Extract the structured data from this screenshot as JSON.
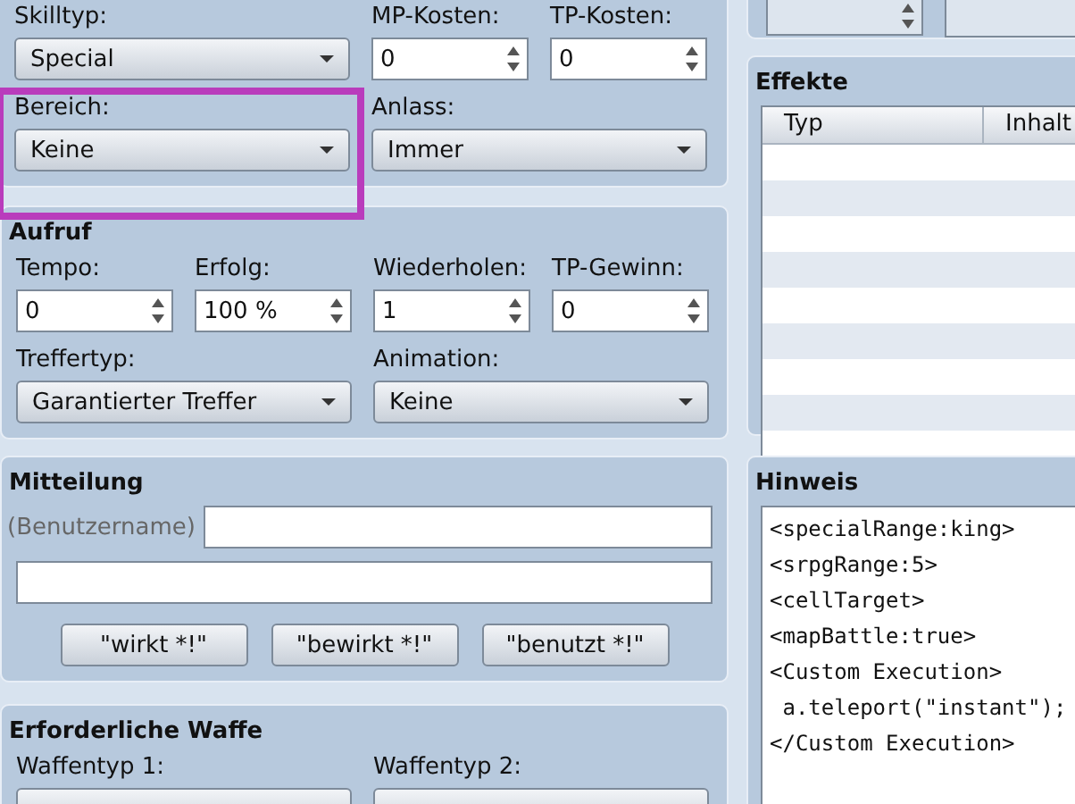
{
  "general": {
    "fields": [
      {
        "kind": "dropdown",
        "label": "Skilltyp:",
        "value": "Special",
        "highlighted": false
      },
      {
        "kind": "spinner",
        "label": "MP-Kosten:",
        "value": "0",
        "highlighted": false
      },
      {
        "kind": "spinner",
        "label": "TP-Kosten:",
        "value": "0",
        "highlighted": false
      },
      {
        "kind": "dropdown",
        "label": "Bereich:",
        "value": "Keine",
        "highlighted": true
      },
      {
        "kind": "dropdown",
        "label": "Anlass:",
        "value": "Immer",
        "highlighted": false
      }
    ]
  },
  "invocation": {
    "title": "Aufruf",
    "fields": [
      {
        "kind": "spinner",
        "label": "Tempo:",
        "value": "0",
        "highlighted": false
      },
      {
        "kind": "spinner",
        "label": "Erfolg:",
        "value": "100 %",
        "highlighted": false
      },
      {
        "kind": "spinner",
        "label": "Wiederholen:",
        "value": "1",
        "highlighted": false
      },
      {
        "kind": "spinner",
        "label": "TP-Gewinn:",
        "value": "0",
        "highlighted": false
      },
      {
        "kind": "dropdown",
        "label": "Treffertyp:",
        "value": "Garantierter Treffer",
        "highlighted": false
      },
      {
        "kind": "dropdown",
        "label": "Animation:",
        "value": "Keine",
        "highlighted": false
      }
    ]
  },
  "message": {
    "title": "Mitteilung",
    "user_label": "(Benutzername)",
    "buttons": [
      "\"wirkt *!\"",
      "\"bewirkt *!\"",
      "\"benutzt *!\""
    ]
  },
  "required_weapon": {
    "title": "Erforderliche Waffe",
    "fields": [
      {
        "kind": "dropdown",
        "label": "Waffentyp 1:",
        "highlighted": false
      },
      {
        "kind": "dropdown",
        "label": "Waffentyp 2:",
        "highlighted": false
      }
    ]
  },
  "right_top": {
    "spinner_disabled": true
  },
  "effects": {
    "title": "Effekte",
    "columns": [
      "Typ",
      "Inhalt"
    ]
  },
  "note": {
    "title": "Hinweis",
    "text": "<specialRange:king>\n<srpgRange:5>\n<cellTarget>\n<mapBattle:true>\n<Custom Execution>\n a.teleport(\"instant\");\n</Custom Execution>"
  }
}
